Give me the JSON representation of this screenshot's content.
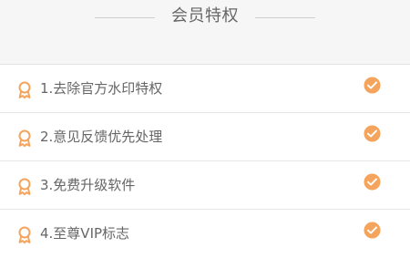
{
  "header": {
    "title": "会员特权"
  },
  "benefits": [
    {
      "label": "1.去除官方水印特权",
      "status_icon": "check-circle-icon",
      "leading_icon": "medal-icon"
    },
    {
      "label": "2.意见反馈优先处理",
      "status_icon": "check-circle-icon",
      "leading_icon": "medal-icon"
    },
    {
      "label": "3.免费升级软件",
      "status_icon": "check-circle-icon",
      "leading_icon": "medal-icon"
    },
    {
      "label": "4.至尊VIP标志",
      "status_icon": "check-circle-icon",
      "leading_icon": "medal-icon"
    }
  ],
  "colors": {
    "accent": "#F4A45C",
    "text": "#666666",
    "divider": "#E6E6E6",
    "background": "#F5F5F5"
  }
}
